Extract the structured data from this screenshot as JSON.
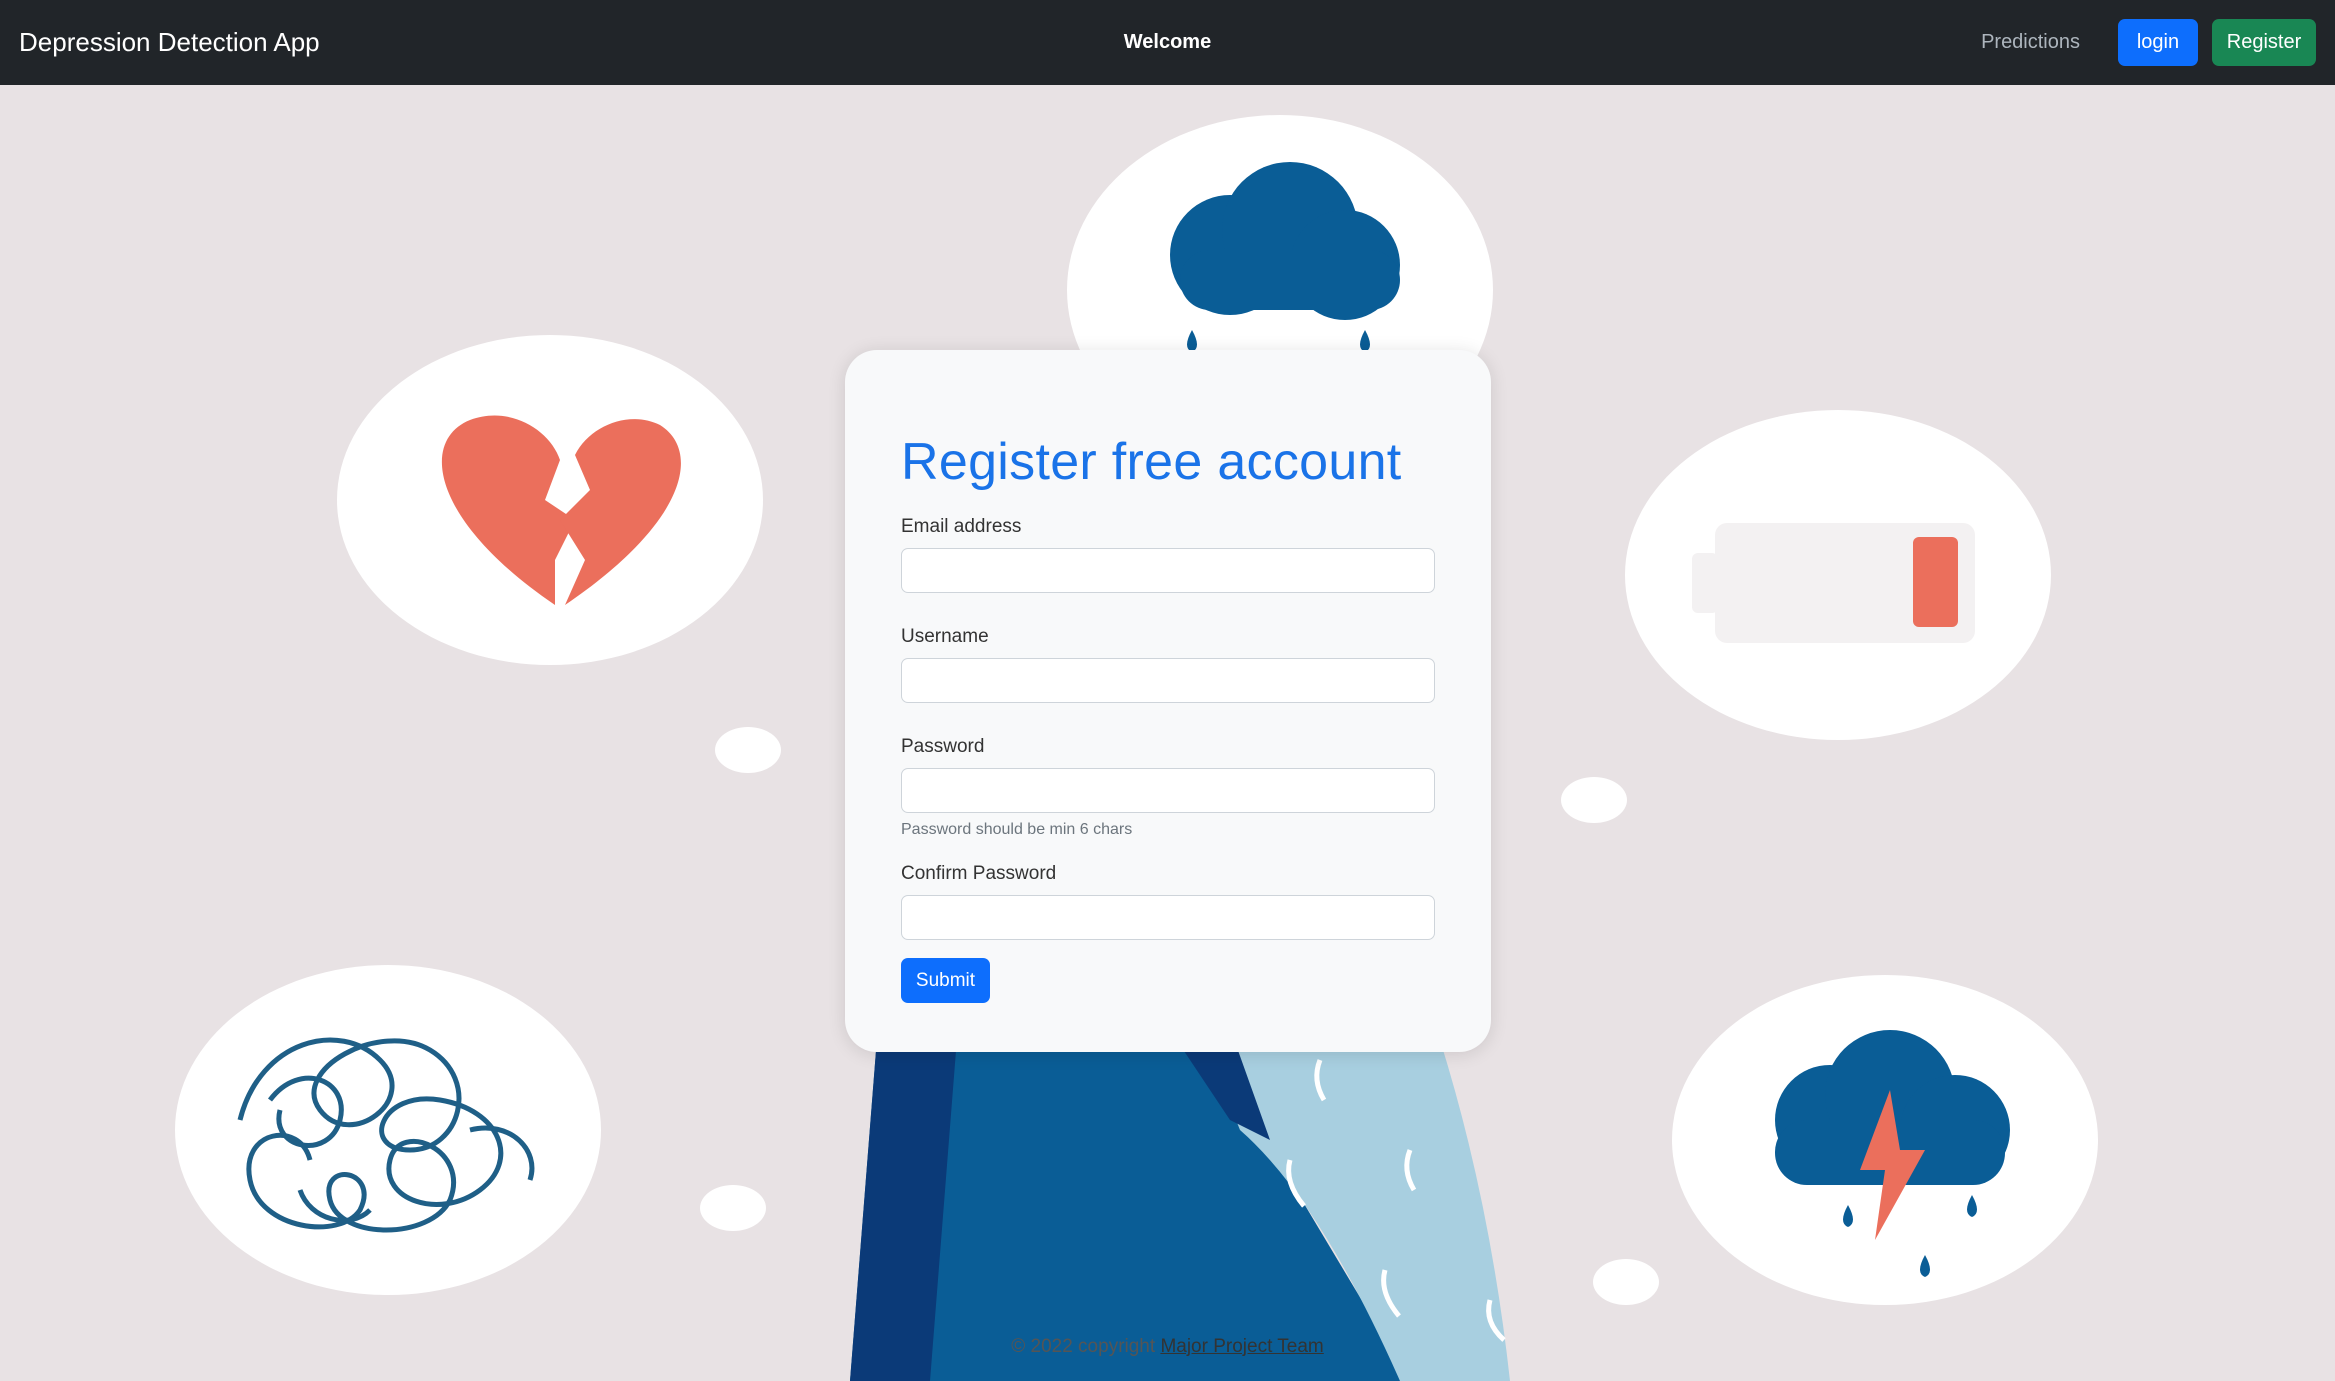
{
  "navbar": {
    "brand": "Depression Detection App",
    "center_title": "Welcome",
    "predictions_link": "Predictions",
    "login_label": "login",
    "register_label": "Register"
  },
  "form": {
    "title": "Register free account",
    "email_label": "Email address",
    "email_value": "",
    "username_label": "Username",
    "username_value": "",
    "password_label": "Password",
    "password_value": "",
    "password_help": "Password should be min 6 chars",
    "confirm_label": "Confirm Password",
    "confirm_value": "",
    "submit_label": "Submit"
  },
  "footer": {
    "prefix": "© 2022 copyright ",
    "link_text": "Major Project Team"
  },
  "colors": {
    "navbar_bg": "#212529",
    "primary": "#0d6efd",
    "success": "#198754",
    "background": "#e8e2e4",
    "heart": "#eb6f5c",
    "cloud_blue": "#0a5d96"
  },
  "icons": [
    "broken-heart-icon",
    "rain-cloud-icon",
    "low-battery-icon",
    "tangled-thoughts-icon",
    "storm-cloud-icon"
  ]
}
